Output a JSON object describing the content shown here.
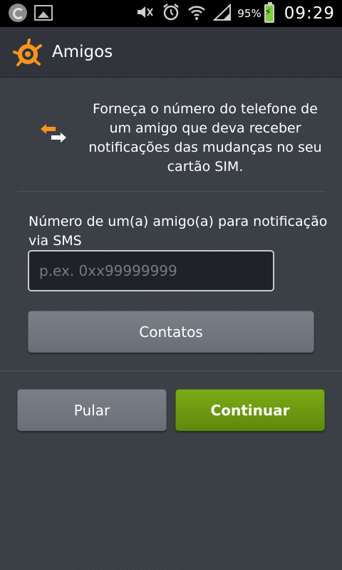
{
  "status_bar": {
    "notification_icons": [
      "avast-notification-icon",
      "gallery-icon"
    ],
    "system_icons": [
      "mute-icon",
      "alarm-icon",
      "wifi-icon",
      "signal-icon"
    ],
    "battery_percent": "95%",
    "time": "09:29"
  },
  "action_bar": {
    "logo_icon": "avast-logo-icon",
    "title": "Amigos"
  },
  "intro": {
    "icon": "swap-arrows-icon",
    "text": "Forneça o número do telefone de um amigo que deva receber notificações das mudanças no seu cartão SIM."
  },
  "form": {
    "field_label": "Número de um(a) amigo(a) para notificação via SMS",
    "phone_input": {
      "value": "",
      "placeholder": "p.ex. 0xx99999999"
    },
    "contacts_button": "Contatos"
  },
  "actions": {
    "skip_button": "Pular",
    "continue_button": "Continuar"
  },
  "colors": {
    "accent_green": "#6f9c12",
    "logo_orange": "#f7941d",
    "background": "#3a3f46",
    "action_bar": "#31353b"
  }
}
